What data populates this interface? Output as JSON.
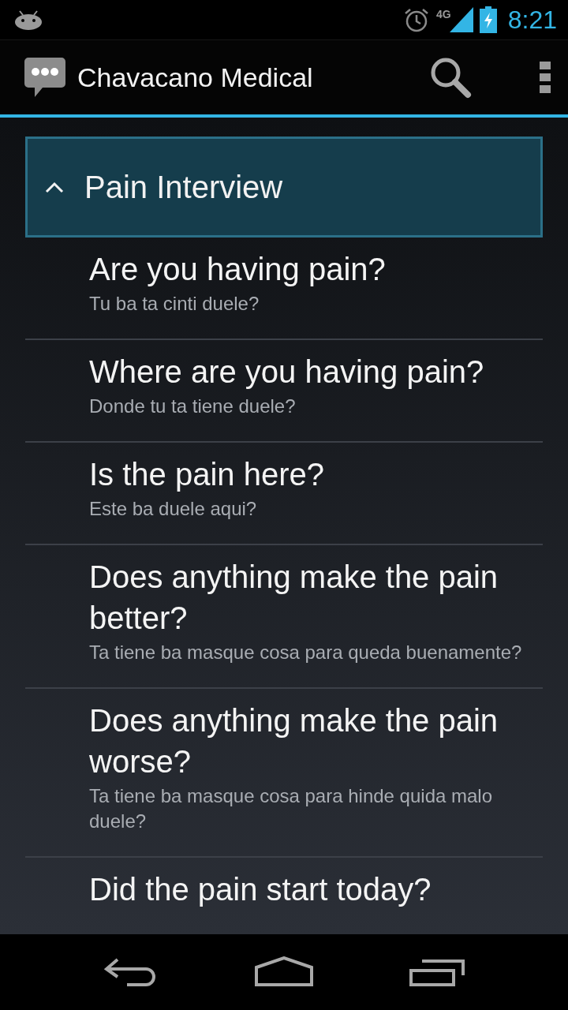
{
  "status_bar": {
    "network": "4G",
    "time": "8:21"
  },
  "action_bar": {
    "title": "Chavacano Medical"
  },
  "group": {
    "title": "Pain Interview",
    "expanded": true,
    "items": [
      {
        "title": "Are you having pain?",
        "subtitle": "Tu ba ta cinti duele?"
      },
      {
        "title": "Where are you having pain?",
        "subtitle": "Donde tu ta tiene duele?"
      },
      {
        "title": "Is the pain here?",
        "subtitle": "Este ba duele aqui?"
      },
      {
        "title": "Does anything make the pain better?",
        "subtitle": "Ta tiene ba masque cosa para queda buenamente?"
      },
      {
        "title": "Does anything make the pain worse?",
        "subtitle": "Ta tiene ba masque cosa para hinde quida malo duele?"
      },
      {
        "title": "Did the pain start today?"
      }
    ]
  }
}
